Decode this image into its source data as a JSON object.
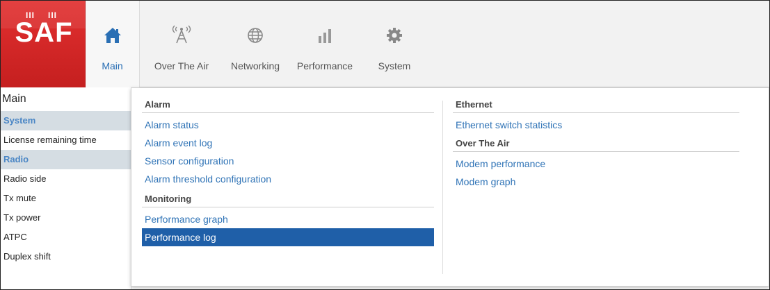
{
  "logo": {
    "text": "SAF",
    "bars_left": "III",
    "bars_right": "III",
    "color": "#d42424"
  },
  "nav": {
    "items": [
      {
        "label": "Main",
        "icon": "home-icon",
        "active": true
      },
      {
        "label": "Over The Air",
        "icon": "antenna-icon",
        "active": false
      },
      {
        "label": "Networking",
        "icon": "globe-icon",
        "active": false
      },
      {
        "label": "Performance",
        "icon": "bar-chart-icon",
        "active": false
      },
      {
        "label": "System",
        "icon": "gear-icon",
        "active": false
      }
    ],
    "accent": "#2a6fb4"
  },
  "sidebar": {
    "title": "Main",
    "rows": [
      {
        "label": "System",
        "header": true
      },
      {
        "label": "License remaining time",
        "header": false
      },
      {
        "label": "Radio",
        "header": true
      },
      {
        "label": "Radio side",
        "header": false
      },
      {
        "label": "Tx mute",
        "header": false
      },
      {
        "label": "Tx power",
        "header": false
      },
      {
        "label": "ATPC",
        "header": false
      },
      {
        "label": "Duplex shift",
        "header": false
      }
    ]
  },
  "dropdown": {
    "left": {
      "alarm": {
        "title": "Alarm",
        "links": [
          "Alarm status",
          "Alarm event log",
          "Sensor configuration",
          "Alarm threshold configuration"
        ]
      },
      "monitoring": {
        "title": "Monitoring",
        "links": [
          "Performance graph",
          "Performance log"
        ],
        "selected": "Performance log"
      }
    },
    "right": {
      "ethernet": {
        "title": "Ethernet",
        "links": [
          "Ethernet switch statistics"
        ]
      },
      "over_the_air": {
        "title": "Over The Air",
        "links": [
          "Modem performance",
          "Modem graph"
        ]
      }
    },
    "selected_color": "#1f5fa8",
    "link_color": "#2f73b6"
  }
}
